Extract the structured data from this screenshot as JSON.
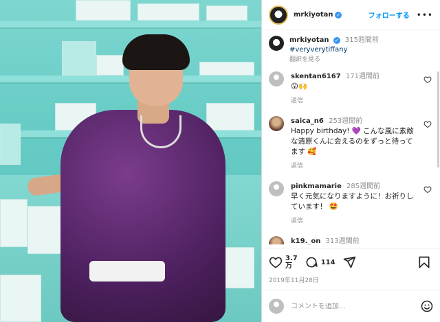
{
  "header": {
    "username": "mrkiyotan",
    "follow_label": "フォローする",
    "more_label": "•••"
  },
  "caption": {
    "username": "mrkiyotan",
    "time": "315週間前",
    "hashtag": "#veryverytiffany",
    "translate": "翻訳を見る"
  },
  "comments": [
    {
      "username": "skentan6167",
      "time": "171週間前",
      "text": "😮🙌",
      "reply": "返信"
    },
    {
      "username": "saica_n6",
      "time": "253週間前",
      "text": "Happy birthday! 💜 こんな風に素敵な清原くんに会えるのをずっと待ってます 🥰",
      "reply": "返信"
    },
    {
      "username": "pinkmamarie",
      "time": "285週間前",
      "text": "早く元気になりますように！お祈りしています！ 🤩",
      "reply": "返信"
    },
    {
      "username": "k19._on",
      "time": "313週間前"
    }
  ],
  "actions": {
    "likes": "3.7\n万",
    "comments_count": "114",
    "date": "2019年11月28日"
  },
  "comment_input": {
    "placeholder": "コメントを追加..."
  }
}
